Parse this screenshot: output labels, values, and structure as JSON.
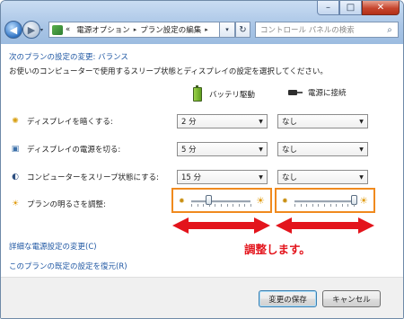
{
  "window": {
    "minimize_glyph": "–",
    "maximize_glyph": "□",
    "close_glyph": "✕"
  },
  "nav": {
    "back_glyph": "◀",
    "forward_glyph": "▶",
    "history_glyph": "▾",
    "breadcrumb": {
      "overflow": "«",
      "items": [
        "電源オプション",
        "プラン設定の編集"
      ],
      "separator": "▸"
    },
    "address_dropdown_glyph": "▾",
    "refresh_glyph": "↻",
    "search_placeholder": "コントロール パネルの検索",
    "search_icon": "⌕"
  },
  "content": {
    "heading": "次のプランの設定の変更: バランス",
    "description": "お使いのコンピューターで使用するスリープ状態とディスプレイの設定を選択してください。",
    "columns": {
      "battery": "バッテリ駆動",
      "plugged": "電源に接続"
    },
    "rows": [
      {
        "icon": "dim-display-icon",
        "icon_glyph": "✺",
        "label": "ディスプレイを暗くする:",
        "battery": "2 分",
        "plugged": "なし"
      },
      {
        "icon": "display-off-icon",
        "icon_glyph": "▣",
        "label": "ディスプレイの電源を切る:",
        "battery": "5 分",
        "plugged": "なし"
      },
      {
        "icon": "sleep-icon",
        "icon_glyph": "◐",
        "label": "コンピューターをスリープ状態にする:",
        "battery": "15 分",
        "plugged": "なし"
      }
    ],
    "brightness": {
      "icon_glyph": "☀",
      "label": "プランの明るさを調整:",
      "dim_glyph": "✹",
      "bright_glyph": "☀",
      "battery_level": 0.3,
      "plugged_level": 1.0
    },
    "annotation": "調整します。",
    "annotation_color": "#e3141c",
    "highlight_color": "#f08a1e",
    "links": {
      "advanced": "詳細な電源設定の変更(C)",
      "restore": "このプランの既定の設定を復元(R)"
    },
    "buttons": {
      "save": "変更の保存",
      "cancel": "キャンセル"
    }
  }
}
